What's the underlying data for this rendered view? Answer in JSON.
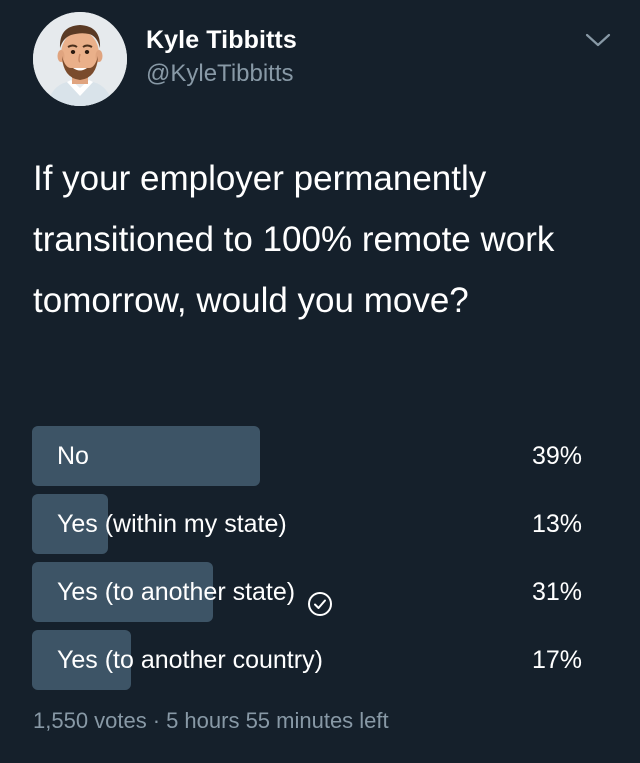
{
  "author": {
    "name": "Kyle Tibbitts",
    "handle": "@KyleTibbitts",
    "avatar_icon": "avatar-illustration-icon"
  },
  "tweet": {
    "text": "If your employer permanently transitioned to 100% remote work tomorrow, would you move?"
  },
  "poll": {
    "options": [
      {
        "label": "No",
        "percent": "39%",
        "fraction": 0.39,
        "selected": false
      },
      {
        "label": "Yes (within my state)",
        "percent": "13%",
        "fraction": 0.13,
        "selected": false
      },
      {
        "label": "Yes (to another state)",
        "percent": "31%",
        "fraction": 0.31,
        "selected": true
      },
      {
        "label": "Yes (to another country)",
        "percent": "17%",
        "fraction": 0.17,
        "selected": false
      }
    ],
    "votes": "1,550 votes",
    "separator": "·",
    "time_left": "5 hours 55 minutes left"
  },
  "colors": {
    "background": "#15202b",
    "bar": "#3d5466",
    "secondary_text": "#8899a6",
    "primary_text": "#ffffff"
  },
  "icons": {
    "menu": "chevron-down-icon",
    "selected": "check-circle-icon"
  }
}
